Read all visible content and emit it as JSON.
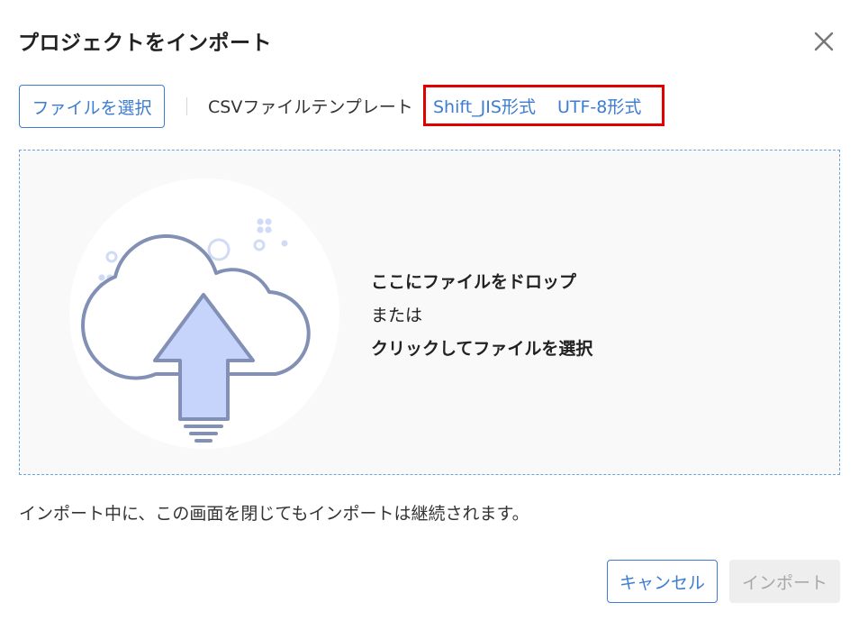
{
  "dialog": {
    "title": "プロジェクトをインポート"
  },
  "toolbar": {
    "select_file_label": "ファイルを選択",
    "template_label": "CSVファイルテンプレート",
    "templates": [
      {
        "label": "Shift_JIS形式"
      },
      {
        "label": "UTF-8形式"
      }
    ]
  },
  "dropzone": {
    "line1": "ここにファイルをドロップ",
    "line2": "または",
    "line3": "クリックしてファイルを選択"
  },
  "notice": "インポート中に、この画面を閉じてもインポートは継続されます。",
  "footer": {
    "cancel_label": "キャンセル",
    "import_label": "インポート"
  },
  "icons": {
    "close": "close-icon",
    "upload": "cloud-upload-icon"
  },
  "colors": {
    "accent": "#3c7dd1",
    "highlight": "#e10000",
    "dropzone_border": "#6aa5e0",
    "illustration_stroke": "#8190b4",
    "illustration_fill": "#c6d3fa",
    "disabled_text": "#a8a8a8"
  }
}
